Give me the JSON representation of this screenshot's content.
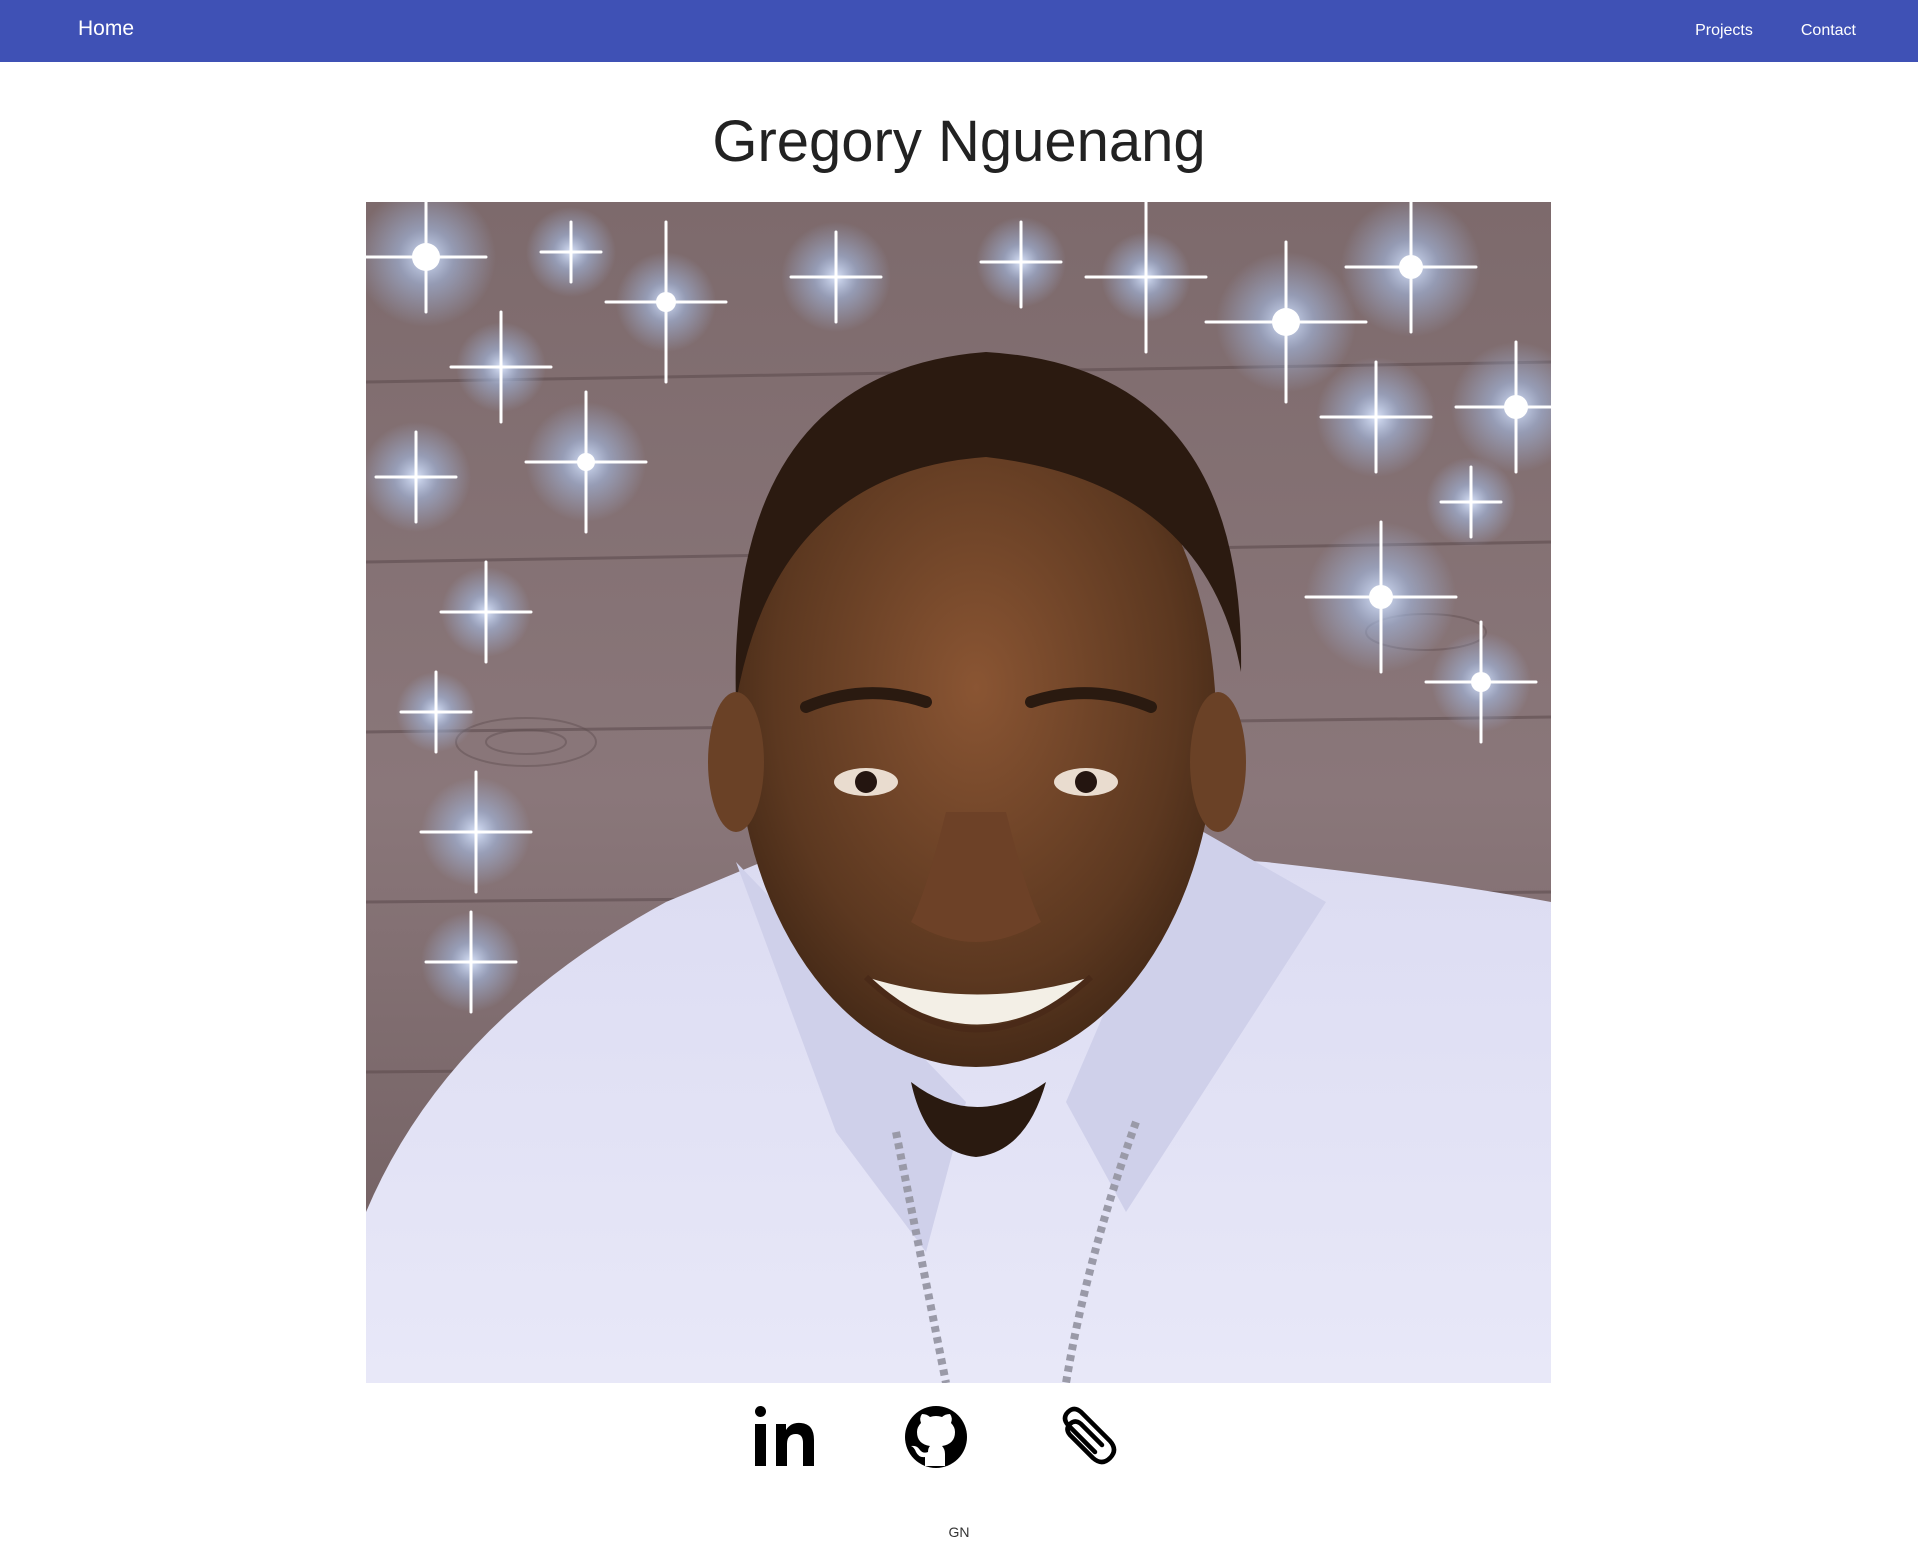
{
  "nav": {
    "home_label": "Home",
    "links": [
      {
        "label": "Projects"
      },
      {
        "label": "Contact"
      }
    ],
    "bg_color": "#3f51b5"
  },
  "main": {
    "title": "Gregory Nguenang",
    "portrait_icon": "profile-photo"
  },
  "social": [
    {
      "icon": "linkedin-icon"
    },
    {
      "icon": "github-icon"
    },
    {
      "icon": "paperclip-icon"
    }
  ],
  "footer": {
    "text": "GN"
  }
}
